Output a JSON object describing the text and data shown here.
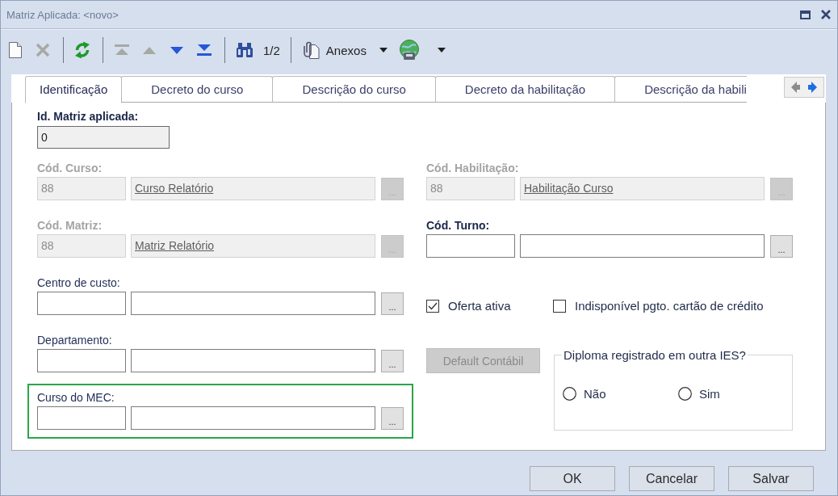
{
  "window": {
    "title": "Matriz Aplicada: <novo>"
  },
  "toolbar": {
    "items": [
      {
        "kind": "new",
        "disabled": false
      },
      {
        "kind": "delete",
        "disabled": true
      },
      {
        "kind": "separator"
      },
      {
        "kind": "refresh",
        "disabled": false
      },
      {
        "kind": "separator"
      },
      {
        "kind": "first",
        "disabled": true
      },
      {
        "kind": "previous",
        "disabled": true
      },
      {
        "kind": "next",
        "disabled": false
      },
      {
        "kind": "last",
        "disabled": false
      },
      {
        "kind": "separator"
      },
      {
        "kind": "find",
        "disabled": false
      },
      {
        "kind": "counter",
        "text": "1/2"
      },
      {
        "kind": "separator"
      },
      {
        "kind": "attachments",
        "label": "Anexos",
        "disabled": false
      },
      {
        "kind": "web",
        "disabled": false
      }
    ]
  },
  "tabs": [
    {
      "label": "Identificação",
      "selected": true
    },
    {
      "label": "Decreto do curso",
      "selected": false
    },
    {
      "label": "Descrição do curso",
      "selected": false
    },
    {
      "label": "Decreto da habilitação",
      "selected": false
    },
    {
      "label": "Descrição da habili",
      "selected": false
    }
  ],
  "tab_scroll": {
    "back_disabled": true,
    "forward_disabled": false
  },
  "form": {
    "id_field": {
      "label": "Id. Matriz aplicada:",
      "value": "0",
      "required": true,
      "readonly": true
    },
    "left_column": [
      {
        "label": "Cód. Curso:",
        "required": true,
        "disabled": true,
        "code": "88",
        "description": "Curso Relatório",
        "browse_button": "...",
        "highlighted": false
      },
      {
        "label": "Cód. Matriz:",
        "required": true,
        "disabled": true,
        "code": "88",
        "description": "Matriz Relatório",
        "browse_button": "...",
        "highlighted": false
      },
      {
        "label": "Centro de custo:",
        "required": false,
        "disabled": false,
        "browse_button": "...",
        "highlighted": false
      },
      {
        "label": "Departamento:",
        "required": false,
        "disabled": false,
        "browse_button": "...",
        "highlighted": false
      },
      {
        "label": "Curso do MEC:",
        "required": false,
        "disabled": false,
        "browse_button": "...",
        "highlighted": true
      }
    ],
    "right_column": {
      "lookups": [
        {
          "label": "Cód. Habilitação:",
          "required": true,
          "disabled": true,
          "code": "88",
          "description": "Habilitação Curso",
          "browse_button": "...",
          "highlighted": false
        },
        {
          "label": "Cód. Turno:",
          "required": true,
          "disabled": false,
          "browse_button": "...",
          "highlighted": false
        }
      ],
      "checkboxes": [
        {
          "label": "Oferta ativa",
          "checked": true
        },
        {
          "label": "Indisponível pgto. cartão de crédito",
          "checked": false
        }
      ],
      "default_button": {
        "label": "Default Contábil",
        "disabled": true
      },
      "diploma_group": {
        "title": "Diploma registrado em outra IES?",
        "options": [
          {
            "label": "Não",
            "selected": false
          },
          {
            "label": "Sim",
            "selected": false
          }
        ]
      }
    }
  },
  "buttons": [
    "OK",
    "Cancelar",
    "Salvar"
  ]
}
